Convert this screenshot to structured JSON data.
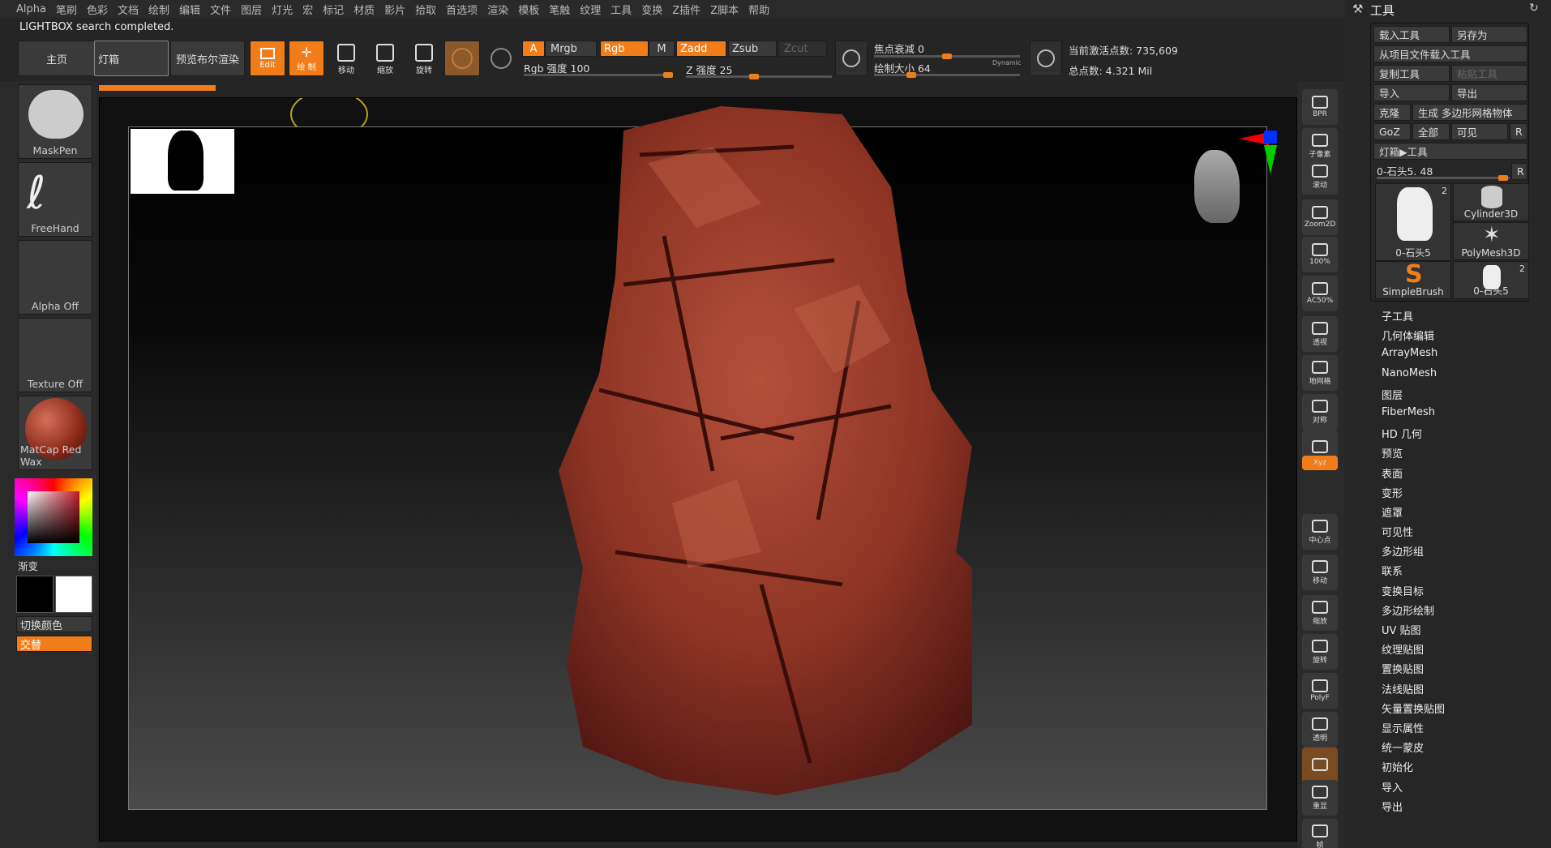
{
  "menu": [
    "Alpha",
    "笔刷",
    "色彩",
    "文档",
    "绘制",
    "编辑",
    "文件",
    "图层",
    "灯光",
    "宏",
    "标记",
    "材质",
    "影片",
    "拾取",
    "首选项",
    "渲染",
    "模板",
    "笔触",
    "纹理",
    "工具",
    "变换",
    "Z插件",
    "Z脚本",
    "帮助"
  ],
  "status": "LIGHTBOX search completed.",
  "top": {
    "home": "主页",
    "lightbox": "灯箱",
    "preview": "预览布尔渲染",
    "edit": "Edit",
    "draw": "绘 制",
    "move": "移动",
    "scale": "缩放",
    "rotate": "旋转",
    "a": "A",
    "mrgb": "Mrgb",
    "rgb": "Rgb",
    "m": "M",
    "zadd": "Zadd",
    "zsub": "Zsub",
    "zcut": "Zcut",
    "rgb_strength": "Rgb 强度 100",
    "z_strength": "Z 强度 25",
    "focal": "焦点衰减 0",
    "draw_size": "绘制大小 64",
    "dynamic": "Dynamic",
    "active_points": "当前激活点数: 735,609",
    "total_points": "总点数: 4.321 Mil"
  },
  "left": {
    "brush": "MaskPen",
    "stroke": "FreeHand",
    "alpha": "Alpha Off",
    "texture": "Texture Off",
    "material": "MatCap Red Wax",
    "gradient": "渐变",
    "switch_color": "切换颜色",
    "alternate": "交替"
  },
  "dock": [
    "BPR",
    "子像素",
    "滚动",
    "Zoom2D",
    "100%",
    "AC50%",
    "透视",
    "地网格",
    "对称",
    "",
    "Xyz",
    "",
    "",
    "中心点",
    "移动",
    "缩放",
    "旋转",
    "PolyF",
    "透明",
    "",
    "重显",
    "帧"
  ],
  "tool": {
    "title": "工具",
    "load": "载入工具",
    "saveas": "另存为",
    "load_project": "从项目文件载入工具",
    "copy": "复制工具",
    "paste": "粘贴工具",
    "import": "导入",
    "export": "导出",
    "clone": "克隆",
    "make_polymesh": "生成 多边形网格物体",
    "goz": "GoZ",
    "all": "全部",
    "visible": "可见",
    "r": "R",
    "lightbox_tool": "灯箱▶工具",
    "current": "0-石头5. 48",
    "cells": [
      "0-石头5",
      "Cylinder3D",
      "PolyMesh3D",
      "SimpleBrush",
      "0-石头5"
    ],
    "cell_counts": [
      "2",
      "2"
    ],
    "list": [
      "子工具",
      "几何体编辑",
      "ArrayMesh",
      "NanoMesh",
      "图层",
      "FiberMesh",
      "HD 几何",
      "预览",
      "表面",
      "变形",
      "遮罩",
      "可见性",
      "多边形组",
      "联系",
      "变换目标",
      "多边形绘制",
      "UV 贴图",
      "纹理贴图",
      "置换贴图",
      "法线贴图",
      "矢量置换贴图",
      "显示属性",
      "统一蒙皮",
      "初始化",
      "导入",
      "导出"
    ]
  }
}
